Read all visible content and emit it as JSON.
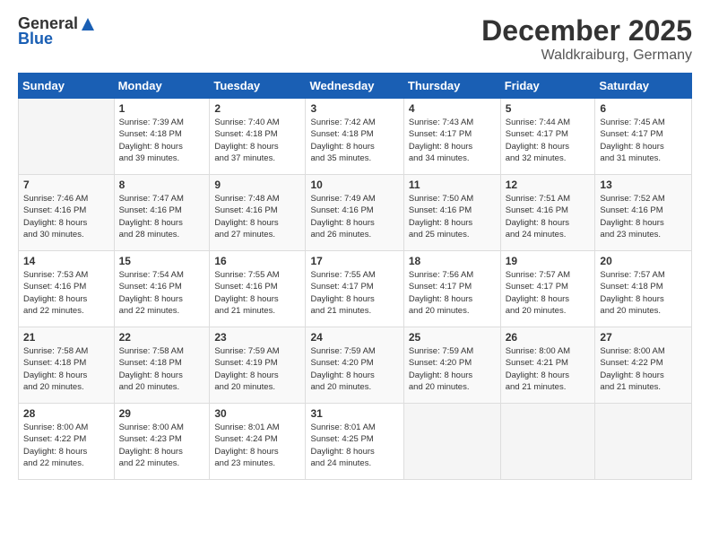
{
  "header": {
    "logo_general": "General",
    "logo_blue": "Blue",
    "month": "December 2025",
    "location": "Waldkraiburg, Germany"
  },
  "days_of_week": [
    "Sunday",
    "Monday",
    "Tuesday",
    "Wednesday",
    "Thursday",
    "Friday",
    "Saturday"
  ],
  "weeks": [
    [
      {
        "day": "",
        "info": ""
      },
      {
        "day": "1",
        "info": "Sunrise: 7:39 AM\nSunset: 4:18 PM\nDaylight: 8 hours\nand 39 minutes."
      },
      {
        "day": "2",
        "info": "Sunrise: 7:40 AM\nSunset: 4:18 PM\nDaylight: 8 hours\nand 37 minutes."
      },
      {
        "day": "3",
        "info": "Sunrise: 7:42 AM\nSunset: 4:18 PM\nDaylight: 8 hours\nand 35 minutes."
      },
      {
        "day": "4",
        "info": "Sunrise: 7:43 AM\nSunset: 4:17 PM\nDaylight: 8 hours\nand 34 minutes."
      },
      {
        "day": "5",
        "info": "Sunrise: 7:44 AM\nSunset: 4:17 PM\nDaylight: 8 hours\nand 32 minutes."
      },
      {
        "day": "6",
        "info": "Sunrise: 7:45 AM\nSunset: 4:17 PM\nDaylight: 8 hours\nand 31 minutes."
      }
    ],
    [
      {
        "day": "7",
        "info": "Sunrise: 7:46 AM\nSunset: 4:16 PM\nDaylight: 8 hours\nand 30 minutes."
      },
      {
        "day": "8",
        "info": "Sunrise: 7:47 AM\nSunset: 4:16 PM\nDaylight: 8 hours\nand 28 minutes."
      },
      {
        "day": "9",
        "info": "Sunrise: 7:48 AM\nSunset: 4:16 PM\nDaylight: 8 hours\nand 27 minutes."
      },
      {
        "day": "10",
        "info": "Sunrise: 7:49 AM\nSunset: 4:16 PM\nDaylight: 8 hours\nand 26 minutes."
      },
      {
        "day": "11",
        "info": "Sunrise: 7:50 AM\nSunset: 4:16 PM\nDaylight: 8 hours\nand 25 minutes."
      },
      {
        "day": "12",
        "info": "Sunrise: 7:51 AM\nSunset: 4:16 PM\nDaylight: 8 hours\nand 24 minutes."
      },
      {
        "day": "13",
        "info": "Sunrise: 7:52 AM\nSunset: 4:16 PM\nDaylight: 8 hours\nand 23 minutes."
      }
    ],
    [
      {
        "day": "14",
        "info": "Sunrise: 7:53 AM\nSunset: 4:16 PM\nDaylight: 8 hours\nand 22 minutes."
      },
      {
        "day": "15",
        "info": "Sunrise: 7:54 AM\nSunset: 4:16 PM\nDaylight: 8 hours\nand 22 minutes."
      },
      {
        "day": "16",
        "info": "Sunrise: 7:55 AM\nSunset: 4:16 PM\nDaylight: 8 hours\nand 21 minutes."
      },
      {
        "day": "17",
        "info": "Sunrise: 7:55 AM\nSunset: 4:17 PM\nDaylight: 8 hours\nand 21 minutes."
      },
      {
        "day": "18",
        "info": "Sunrise: 7:56 AM\nSunset: 4:17 PM\nDaylight: 8 hours\nand 20 minutes."
      },
      {
        "day": "19",
        "info": "Sunrise: 7:57 AM\nSunset: 4:17 PM\nDaylight: 8 hours\nand 20 minutes."
      },
      {
        "day": "20",
        "info": "Sunrise: 7:57 AM\nSunset: 4:18 PM\nDaylight: 8 hours\nand 20 minutes."
      }
    ],
    [
      {
        "day": "21",
        "info": "Sunrise: 7:58 AM\nSunset: 4:18 PM\nDaylight: 8 hours\nand 20 minutes."
      },
      {
        "day": "22",
        "info": "Sunrise: 7:58 AM\nSunset: 4:18 PM\nDaylight: 8 hours\nand 20 minutes."
      },
      {
        "day": "23",
        "info": "Sunrise: 7:59 AM\nSunset: 4:19 PM\nDaylight: 8 hours\nand 20 minutes."
      },
      {
        "day": "24",
        "info": "Sunrise: 7:59 AM\nSunset: 4:20 PM\nDaylight: 8 hours\nand 20 minutes."
      },
      {
        "day": "25",
        "info": "Sunrise: 7:59 AM\nSunset: 4:20 PM\nDaylight: 8 hours\nand 20 minutes."
      },
      {
        "day": "26",
        "info": "Sunrise: 8:00 AM\nSunset: 4:21 PM\nDaylight: 8 hours\nand 21 minutes."
      },
      {
        "day": "27",
        "info": "Sunrise: 8:00 AM\nSunset: 4:22 PM\nDaylight: 8 hours\nand 21 minutes."
      }
    ],
    [
      {
        "day": "28",
        "info": "Sunrise: 8:00 AM\nSunset: 4:22 PM\nDaylight: 8 hours\nand 22 minutes."
      },
      {
        "day": "29",
        "info": "Sunrise: 8:00 AM\nSunset: 4:23 PM\nDaylight: 8 hours\nand 22 minutes."
      },
      {
        "day": "30",
        "info": "Sunrise: 8:01 AM\nSunset: 4:24 PM\nDaylight: 8 hours\nand 23 minutes."
      },
      {
        "day": "31",
        "info": "Sunrise: 8:01 AM\nSunset: 4:25 PM\nDaylight: 8 hours\nand 24 minutes."
      },
      {
        "day": "",
        "info": ""
      },
      {
        "day": "",
        "info": ""
      },
      {
        "day": "",
        "info": ""
      }
    ]
  ]
}
